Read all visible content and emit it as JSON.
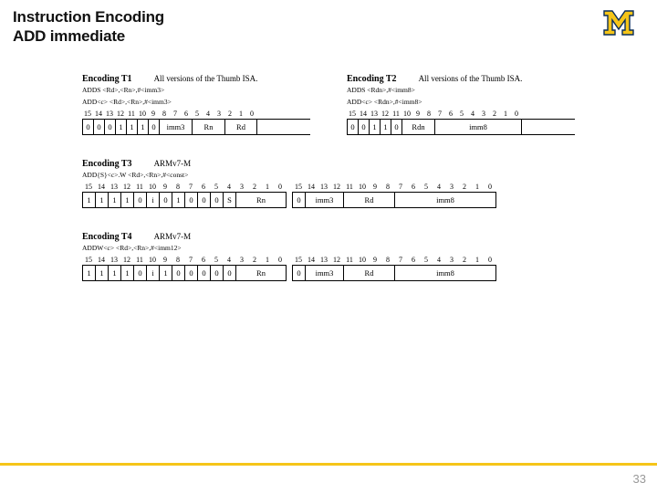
{
  "title_l1": "Instruction Encoding",
  "title_l2": "ADD immediate",
  "page": "33",
  "t1": {
    "name": "Encoding T1",
    "note": "All versions of the Thumb ISA.",
    "syn1": "ADDS <Rd>,<Rn>,#<imm3>",
    "syn2": "ADD<c> <Rd>,<Rn>,#<imm3>",
    "bits": [
      "15",
      "14",
      "13",
      "12",
      "11",
      "10",
      "9",
      "8",
      "7",
      "6",
      "5",
      "4",
      "3",
      "2",
      "1",
      "0"
    ],
    "vals": [
      "0",
      "0",
      "0",
      "1",
      "1",
      "1",
      "0"
    ],
    "f_imm": "imm3",
    "f_rn": "Rn",
    "f_rd": "Rd"
  },
  "t2": {
    "name": "Encoding T2",
    "note": "All versions of the Thumb ISA.",
    "syn1": "ADDS <Rdn>,#<imm8>",
    "syn2": "ADD<c> <Rdn>,#<imm8>",
    "bits": [
      "15",
      "14",
      "13",
      "12",
      "11",
      "10",
      "9",
      "8",
      "7",
      "6",
      "5",
      "4",
      "3",
      "2",
      "1",
      "0"
    ],
    "vals": [
      "0",
      "0",
      "1",
      "1",
      "0"
    ],
    "f_rdn": "Rdn",
    "f_imm": "imm8"
  },
  "t3": {
    "name": "Encoding T3",
    "note": "ARMv7-M",
    "syn1": "ADD{S}<c>.W <Rd>,<Rn>,#<const>",
    "bits_hi": [
      "15",
      "14",
      "13",
      "12",
      "11",
      "10",
      "9",
      "8",
      "7",
      "6",
      "5",
      "4",
      "3",
      "2",
      "1",
      "0"
    ],
    "bits_lo": [
      "15",
      "14",
      "13",
      "12",
      "11",
      "10",
      "9",
      "8",
      "7",
      "6",
      "5",
      "4",
      "3",
      "2",
      "1",
      "0"
    ],
    "hi_vals": [
      "1",
      "1",
      "1",
      "1",
      "0"
    ],
    "hi_i": "i",
    "hi_mid": [
      "0",
      "1",
      "0",
      "0",
      "0"
    ],
    "hi_s": "S",
    "hi_rn": "Rn",
    "lo_z": "0",
    "lo_imm3": "imm3",
    "lo_rd": "Rd",
    "lo_imm8": "imm8"
  },
  "t4": {
    "name": "Encoding T4",
    "note": "ARMv7-M",
    "syn1": "ADDW<c> <Rd>,<Rn>,#<imm12>",
    "bits_hi": [
      "15",
      "14",
      "13",
      "12",
      "11",
      "10",
      "9",
      "8",
      "7",
      "6",
      "5",
      "4",
      "3",
      "2",
      "1",
      "0"
    ],
    "bits_lo": [
      "15",
      "14",
      "13",
      "12",
      "11",
      "10",
      "9",
      "8",
      "7",
      "6",
      "5",
      "4",
      "3",
      "2",
      "1",
      "0"
    ],
    "hi_vals": [
      "1",
      "1",
      "1",
      "1",
      "0"
    ],
    "hi_i": "i",
    "hi_mid": [
      "1",
      "0",
      "0",
      "0",
      "0",
      "0"
    ],
    "hi_rn": "Rn",
    "lo_z": "0",
    "lo_imm3": "imm3",
    "lo_rd": "Rd",
    "lo_imm8": "imm8"
  }
}
